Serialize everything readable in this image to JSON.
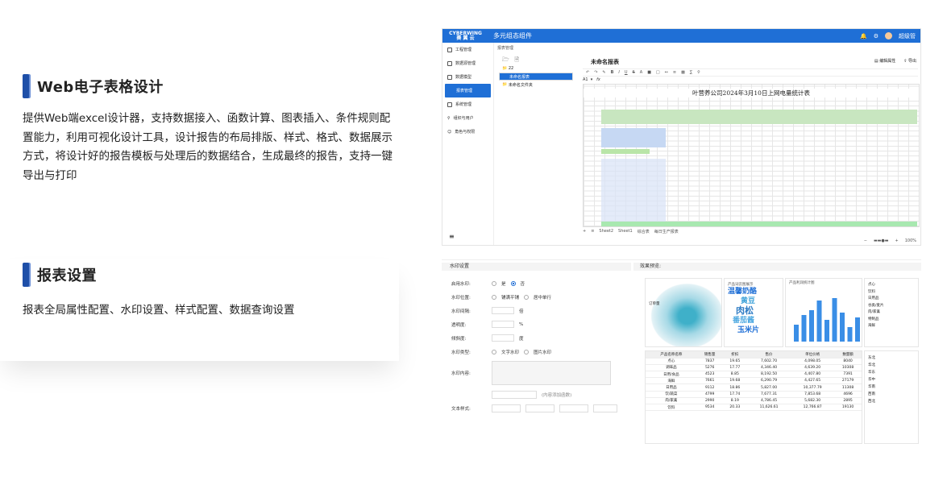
{
  "feature1": {
    "title": "Web电子表格设计",
    "desc": "提供Web端excel设计器，支持数据接入、函数计算、图表插入、条件规则配置能力，利用可视化设计工具，设计报告的布局排版、样式、格式、数据展示方式，将设计好的报告模板与处理后的数据结合，生成最终的报告，支持一键导出与打印"
  },
  "feature2": {
    "title": "报表设置",
    "desc": "报表全局属性配置、水印设置、样式配置、数据查询设置"
  },
  "app": {
    "logo_line1": "CYBERWING",
    "logo_line2": "赛 翼 云",
    "title": "多元组态组件",
    "user": "超级管",
    "breadcrumb": "报表管理"
  },
  "sidebar": {
    "items": [
      {
        "label": "工程管理"
      },
      {
        "label": "数据源管理"
      },
      {
        "label": "数据模型"
      },
      {
        "label": "报表管理"
      },
      {
        "label": "系统管理"
      },
      {
        "label": "组织与用户"
      },
      {
        "label": "角色与权限"
      }
    ]
  },
  "tree": {
    "root": "22",
    "items": [
      "未命名报表",
      "未命名文件夹"
    ]
  },
  "sheet": {
    "title": "未命名报表",
    "btn_save": "编辑属性",
    "btn_export": "导出",
    "cell_ref": "A1",
    "report_title": "叶营养公司2024年3月10日上网电量统计表",
    "tabs": [
      "Sheet2",
      "Sheet1",
      "综合表",
      "每日生产报表"
    ],
    "zoom": "100%"
  },
  "settings": {
    "section_left": "水印设置",
    "section_right": "效果预览:",
    "enable_label": "启用水印:",
    "opt_yes": "是",
    "opt_no": "否",
    "position_label": "水印位置:",
    "pos_opt1": "铺满平铺",
    "pos_opt2": "居中单行",
    "spacing_label": "水印间隔:",
    "spacing_unit": "倍",
    "opacity_label": "透明度:",
    "opacity_unit": "%",
    "angle_label": "倾斜度:",
    "angle_unit": "度",
    "type_label": "水印类型:",
    "type_opt1": "文字水印",
    "type_opt2": "图片水印",
    "content_label": "水印内容:",
    "hint": "(内容添加函数)",
    "style_label": "文本样式:"
  },
  "preview": {
    "map_label": "订单量",
    "wordcloud_title": "产品词云图展示",
    "bar_title": "产品利润统计图",
    "words": [
      "温馨奶酪",
      "黄豆",
      "肉松",
      "番茄酱",
      "玉米片"
    ],
    "table_head": [
      "产品名称名称",
      "销售量",
      "折扣",
      "售价",
      "单位价格",
      "数量额"
    ],
    "table_rows": [
      [
        "点心",
        "7837",
        "19.65",
        "7,602.70",
        "4,098.05",
        "8040"
      ],
      [
        "调味品",
        "5276",
        "17.77",
        "4,346.40",
        "4,639.20",
        "10308"
      ],
      [
        "日用/食品",
        "4523",
        "8.85",
        "8,192.50",
        "4,407.80",
        "7391"
      ],
      [
        "海鲜",
        "7661",
        "19.68",
        "6,290.79",
        "4,427.65",
        "27179"
      ],
      [
        "日用品",
        "9112",
        "18.86",
        "5,827.00",
        "10,377.79",
        "11308"
      ],
      [
        "饮/蔬菜",
        "4799",
        "17.74",
        "7,677.31",
        "7,853.68",
        "4696"
      ],
      [
        "肉/家禽",
        "2990",
        "8.19",
        "4,786.45",
        "5,682.30",
        "2895"
      ],
      [
        "饮料",
        "9534",
        "20.33",
        "11,626.61",
        "12,766.87",
        "19130"
      ]
    ],
    "legend1": [
      "点心",
      "饮料",
      "日用品",
      "谷类/麦片",
      "肉/家禽",
      "特制品",
      "海鲜"
    ],
    "legend2": [
      "东北",
      "华北",
      "华东",
      "华中",
      "华南",
      "西南",
      "西北"
    ],
    "bar_values": [
      0.35,
      0.55,
      0.65,
      0.85,
      0.45,
      0.9,
      0.6,
      0.3,
      0.5
    ]
  }
}
